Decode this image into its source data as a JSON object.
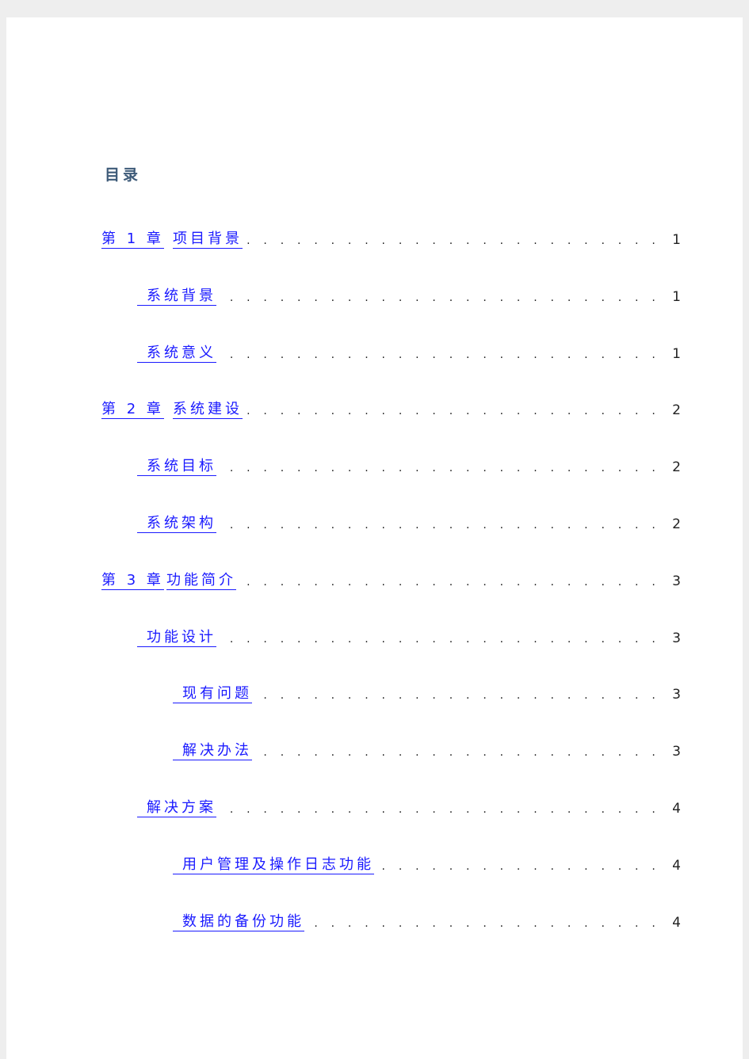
{
  "toc": {
    "title": "目录",
    "entries": [
      {
        "chapter": "第 1 章",
        "label": "项目背景",
        "page": "1",
        "level": 1
      },
      {
        "label": "系统背景",
        "page": "1",
        "level": 2
      },
      {
        "label": "系统意义",
        "page": "1",
        "level": 2
      },
      {
        "chapter": "第 2 章",
        "label": "系统建设",
        "page": "2",
        "level": 1
      },
      {
        "label": "系统目标",
        "page": "2",
        "level": 2
      },
      {
        "label": "系统架构",
        "page": "2",
        "level": 2
      },
      {
        "chapter": "第 3 章",
        "label": "功能简介",
        "page": "3",
        "level": 1,
        "combined": true
      },
      {
        "label": "功能设计",
        "page": "3",
        "level": 2
      },
      {
        "label": "现有问题",
        "page": "3",
        "level": 3
      },
      {
        "label": "解决办法",
        "page": "3",
        "level": 3
      },
      {
        "label": "解决方案",
        "page": "4",
        "level": 2
      },
      {
        "label": "用户管理及操作日志功能",
        "page": "4",
        "level": 3
      },
      {
        "label": "数据的备份功能",
        "page": "4",
        "level": 3
      }
    ]
  },
  "colors": {
    "link": "#1a1aff",
    "title": "#3d5a78"
  }
}
